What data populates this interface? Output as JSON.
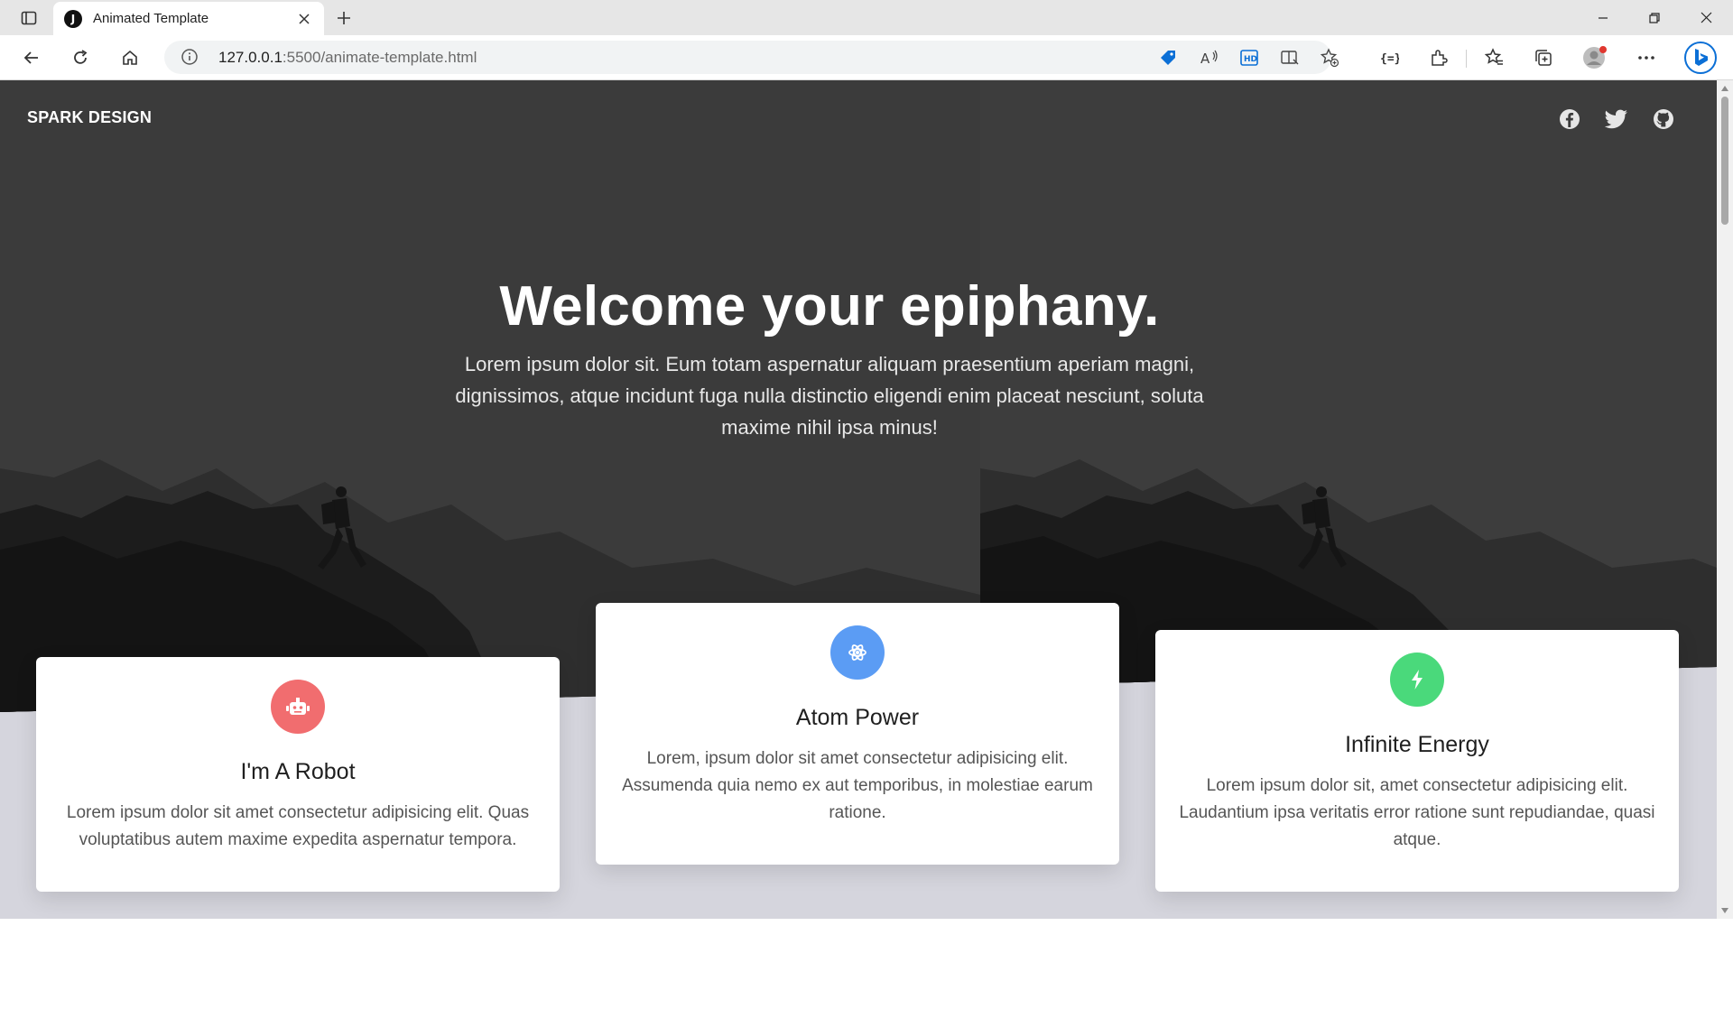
{
  "browser": {
    "tab_title": "Animated Template",
    "tab_favicon_letter": "J",
    "url_host": "127.0.0.1",
    "url_rest": ":5500/animate-template.html"
  },
  "site": {
    "brand": "SPARK DESIGN",
    "social_icons": [
      "facebook-icon",
      "twitter-icon",
      "github-icon"
    ],
    "hero": {
      "title": "Welcome your epiphany.",
      "text": "Lorem ipsum dolor sit. Eum totam aspernatur aliquam praesentium aperiam magni, dignissimos, atque incidunt fuga nulla distinctio eligendi enim placeat nesciunt, soluta maxime nihil ipsa minus!"
    },
    "cards": [
      {
        "title": "I'm A Robot",
        "text": "Lorem ipsum dolor sit amet consectetur adipisicing elit. Quas voluptatibus autem maxime expedita aspernatur tempora.",
        "icon": "robot-icon",
        "color": "#f16d6f"
      },
      {
        "title": "Atom Power",
        "text": "Lorem, ipsum dolor sit amet consectetur adipisicing elit. Assumenda quia nemo ex aut temporibus, in molestiae earum ratione.",
        "icon": "atom-icon",
        "color": "#5b9cf4"
      },
      {
        "title": "Infinite Energy",
        "text": "Lorem ipsum dolor sit, amet consectetur adipisicing elit. Laudantium ipsa veritatis error ratione sunt repudiandae, quasi atque.",
        "icon": "bolt-icon",
        "color": "#4ad97b"
      }
    ]
  },
  "colors": {
    "hero_overlay": "#3b3b3b",
    "page_background": "#d5d5dd",
    "browser_accent": "#0b6fd6"
  }
}
